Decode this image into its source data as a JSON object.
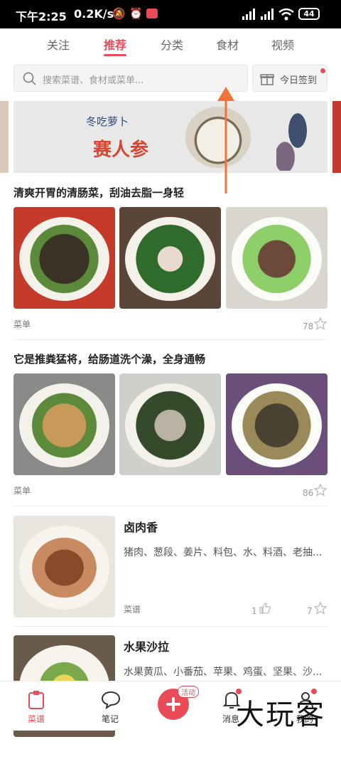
{
  "status_bar": {
    "time": "下午2:25",
    "net_speed": "0.2K/s",
    "battery": "44"
  },
  "top_tabs": [
    {
      "label": "关注",
      "active": false
    },
    {
      "label": "推荐",
      "active": true
    },
    {
      "label": "分类",
      "active": false
    },
    {
      "label": "食材",
      "active": false
    },
    {
      "label": "视频",
      "active": false
    }
  ],
  "search": {
    "placeholder": "搜索菜谱、食材或菜单..."
  },
  "checkin": {
    "label": "今日签到"
  },
  "banner": {
    "small_text": "冬吃萝卜",
    "big_text": "赛人参"
  },
  "collections": [
    {
      "title": "清爽开胃的清肠菜，刮油去脂一身轻",
      "type_label": "菜单",
      "fav_count": "78"
    },
    {
      "title": "它是推粪猛将，给肠道洗个澡，全身通畅",
      "type_label": "菜单",
      "fav_count": "86"
    }
  ],
  "recipes": [
    {
      "title": "卤肉香",
      "ingredients": "猪肉、葱段、姜片、料包、水、料酒、老抽...",
      "type_label": "菜谱",
      "like_count": "1",
      "fav_count": "7"
    },
    {
      "title": "水果沙拉",
      "ingredients": "水果黄瓜、小番茄、苹果、鸡蛋、坚果、沙..."
    }
  ],
  "bottom_nav": {
    "items": [
      {
        "label": "菜谱",
        "active": true
      },
      {
        "label": "笔记",
        "active": false
      },
      {
        "label": "消息",
        "active": false
      },
      {
        "label": "我的",
        "active": false
      }
    ],
    "activity_badge": "活动"
  },
  "watermark": "大玩客",
  "colors": {
    "accent": "#e94b58",
    "text": "#222222",
    "muted": "#999999"
  }
}
